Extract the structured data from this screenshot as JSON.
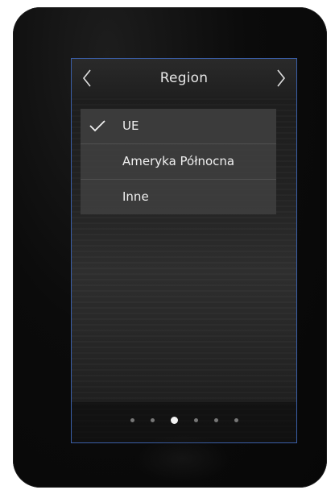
{
  "header": {
    "title": "Region",
    "prev_icon": "chevron-left-icon",
    "next_icon": "chevron-right-icon"
  },
  "region_list": {
    "items": [
      {
        "label": "UE",
        "selected": true
      },
      {
        "label": "Ameryka Północna",
        "selected": false
      },
      {
        "label": "Inne",
        "selected": false
      }
    ]
  },
  "pagination": {
    "count": 6,
    "active_index": 2
  },
  "colors": {
    "screen_border": "#3a5fa8",
    "item_background": "#3e3e3e",
    "text": "#f0f0f0"
  }
}
